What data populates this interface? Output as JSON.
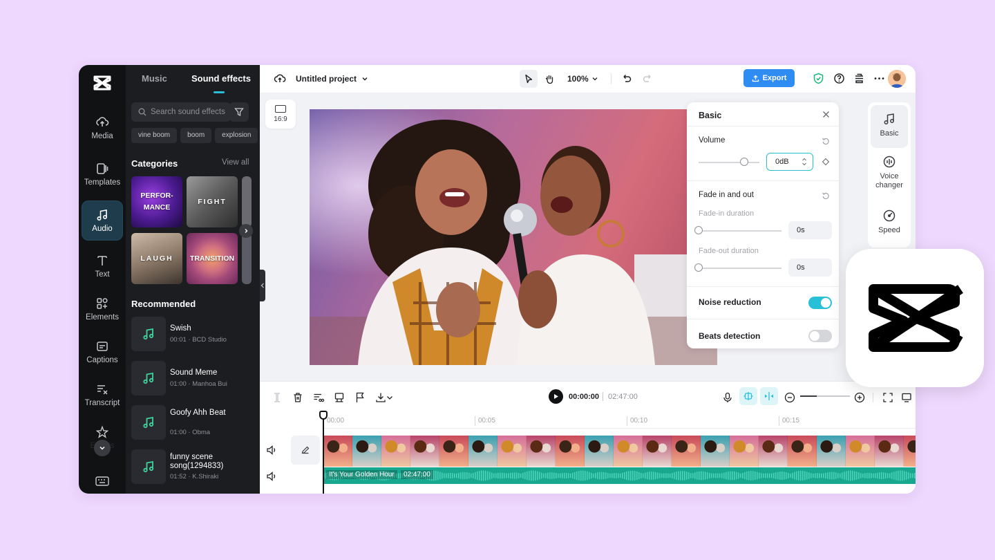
{
  "app": {
    "project_title": "Untitled project",
    "zoom": "100%",
    "export_label": "Export"
  },
  "rail": {
    "items": [
      {
        "label": "Media",
        "icon": "cloud-upload-icon"
      },
      {
        "label": "Templates",
        "icon": "templates-icon"
      },
      {
        "label": "Audio",
        "icon": "music-note-icon",
        "active": true
      },
      {
        "label": "Text",
        "icon": "text-icon"
      },
      {
        "label": "Elements",
        "icon": "elements-icon"
      },
      {
        "label": "Captions",
        "icon": "captions-icon"
      },
      {
        "label": "Transcript",
        "icon": "transcript-icon"
      },
      {
        "label": "Effects",
        "icon": "effects-icon"
      }
    ]
  },
  "library": {
    "tabs": [
      "Music",
      "Sound effects"
    ],
    "active_tab": "Sound effects",
    "search_placeholder": "Search sound effects",
    "chips": [
      "vine boom",
      "boom",
      "explosion"
    ],
    "categories_title": "Categories",
    "view_all": "View all",
    "categories": [
      {
        "label": "PERFOR-\nMANCE"
      },
      {
        "label": "FIGHT"
      },
      {
        "label": "LAUGH"
      },
      {
        "label": "TRANSITION"
      }
    ],
    "recommended_title": "Recommended",
    "tracks": [
      {
        "name": "Swish",
        "meta": "00:01 · BCD Studio"
      },
      {
        "name": "Sound Meme",
        "meta": "01:00 · Manhoa Bui"
      },
      {
        "name": "Goofy Ahh Beat",
        "meta": "01:00 · Obma"
      },
      {
        "name": "funny scene song(1294833)",
        "meta": "01:52 · K.Shiraki"
      }
    ]
  },
  "canvas": {
    "ratio": "16:9"
  },
  "properties": {
    "title": "Basic",
    "volume_label": "Volume",
    "volume_value": "0dB",
    "fade_label": "Fade in and out",
    "fade_in_label": "Fade-in duration",
    "fade_in_value": "0s",
    "fade_out_label": "Fade-out duration",
    "fade_out_value": "0s",
    "noise_label": "Noise reduction",
    "noise_on": true,
    "beats_label": "Beats detection",
    "beats_on": false
  },
  "right_tabs": [
    {
      "label": "Basic",
      "icon": "music-note-icon"
    },
    {
      "label": "Voice changer",
      "icon": "voice-changer-icon"
    },
    {
      "label": "Speed",
      "icon": "speed-icon"
    }
  ],
  "timeline": {
    "current_time": "00:00:00",
    "total_time": "02:47:00",
    "ruler": [
      "00:00",
      "00:05",
      "00:10",
      "00:15"
    ],
    "audio_clip_name": "It's Your Golden Hour",
    "audio_clip_duration": "02:47:00"
  },
  "colors": {
    "accent": "#28c0d6",
    "export": "#2f8cf2",
    "audio_track": "#17a88f",
    "rail_bg": "#111214",
    "panel_bg": "#1c1d21",
    "page_bg": "#eed8fd"
  }
}
